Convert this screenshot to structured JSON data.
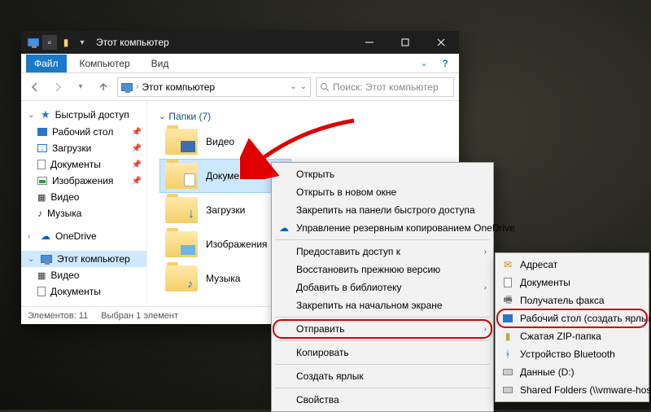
{
  "window": {
    "title": "Этот компьютер",
    "tabs": {
      "file": "Файл",
      "computer": "Компьютер",
      "view": "Вид"
    }
  },
  "addressbar": {
    "location": "Этот компьютер"
  },
  "search": {
    "placeholder": "Поиск: Этот компьютер"
  },
  "nav": {
    "quick_access": "Быстрый доступ",
    "items": [
      {
        "label": "Рабочий стол",
        "icon": "desktop"
      },
      {
        "label": "Загрузки",
        "icon": "downloads"
      },
      {
        "label": "Документы",
        "icon": "documents"
      },
      {
        "label": "Изображения",
        "icon": "pictures"
      },
      {
        "label": "Видео",
        "icon": "video"
      },
      {
        "label": "Музыка",
        "icon": "music"
      }
    ],
    "onedrive": "OneDrive",
    "this_pc": "Этот компьютер",
    "this_pc_children": [
      {
        "label": "Видео"
      },
      {
        "label": "Документы"
      }
    ]
  },
  "content": {
    "group_header": "Папки (7)",
    "folders": [
      {
        "label": "Видео"
      },
      {
        "label": "Документы"
      },
      {
        "label": "Загрузки"
      },
      {
        "label": "Изображения"
      },
      {
        "label": "Музыка"
      }
    ]
  },
  "status": {
    "count": "Элементов: 11",
    "selection": "Выбран 1 элемент"
  },
  "context_menu": {
    "items": [
      "Открыть",
      "Открыть в новом окне",
      "Закрепить на панели быстрого доступа",
      "Управление резервным копированием OneDrive",
      "Предоставить доступ к",
      "Восстановить прежнюю версию",
      "Добавить в библиотеку",
      "Закрепить на начальном экране",
      "Отправить",
      "Копировать",
      "Создать ярлык",
      "Свойства"
    ]
  },
  "submenu": {
    "items": [
      "Адресат",
      "Документы",
      "Получатель факса",
      "Рабочий стол (создать ярлык)",
      "Сжатая ZIP-папка",
      "Устройство Bluetooth",
      "Данные (D:)",
      "Shared Folders (\\\\vmware-host) (Z:)"
    ]
  }
}
